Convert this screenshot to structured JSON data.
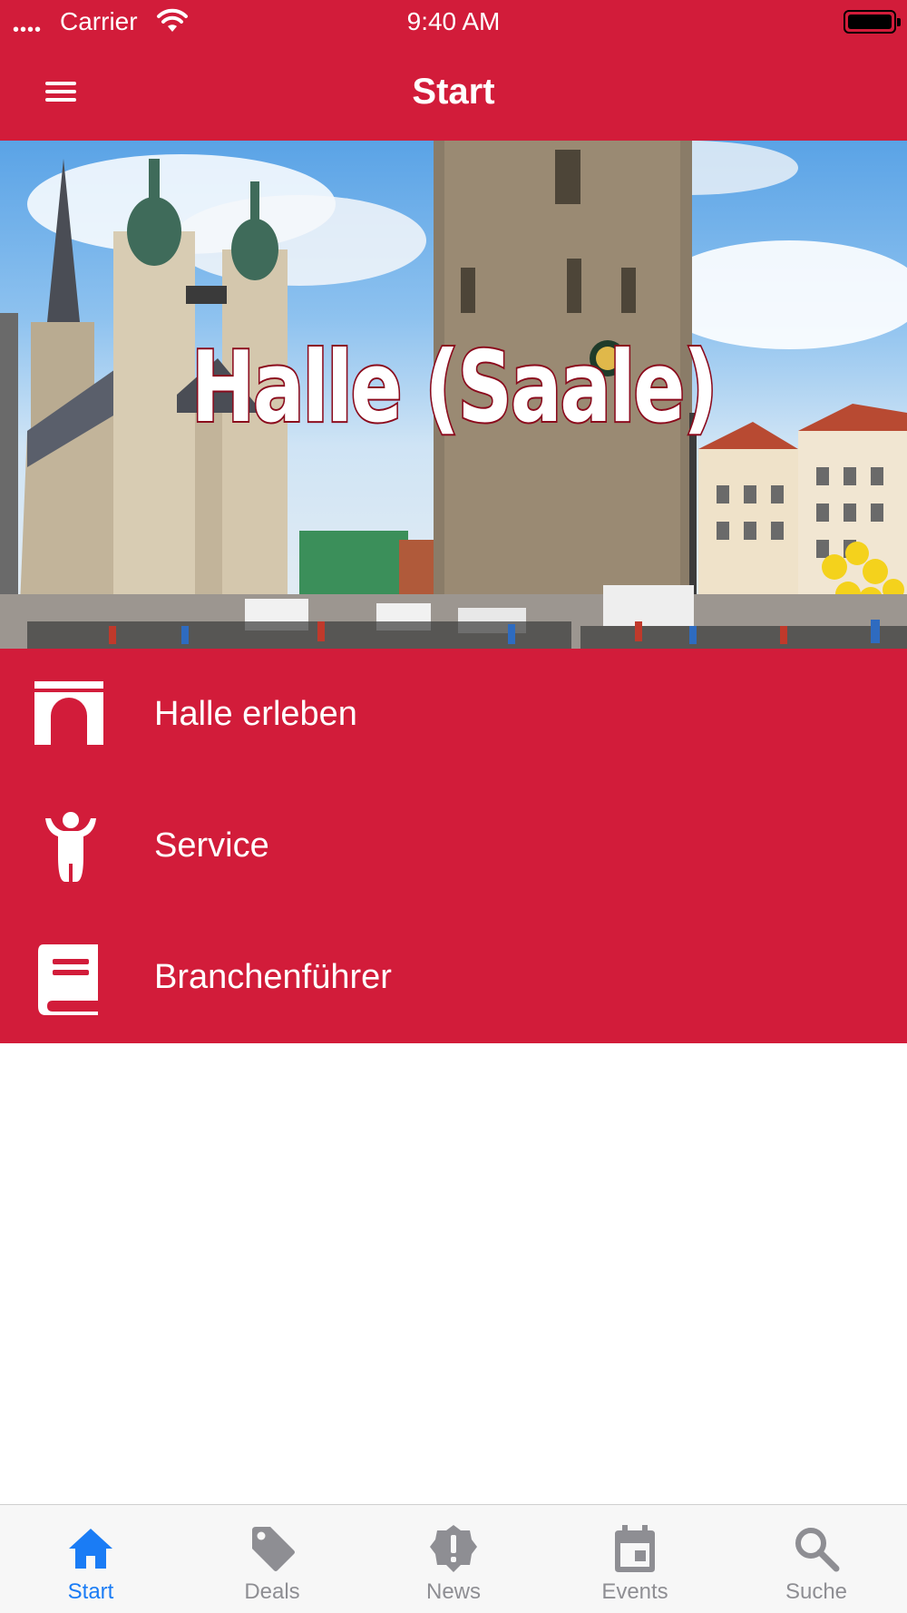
{
  "status_bar": {
    "carrier": "Carrier",
    "time": "9:40 AM",
    "icons": [
      "signal-dots",
      "wifi-icon",
      "battery-icon"
    ]
  },
  "nav_bar": {
    "title": "Start",
    "menu_icon": "hamburger-menu-icon"
  },
  "hero": {
    "title": "Halle (Saale)"
  },
  "menu": {
    "items": [
      {
        "label": "Halle erleben",
        "icon": "gate-arch-icon"
      },
      {
        "label": "Service",
        "icon": "person-icon"
      },
      {
        "label": "Branchenführer",
        "icon": "book-icon"
      }
    ]
  },
  "tab_bar": {
    "items": [
      {
        "label": "Start",
        "icon": "home-icon",
        "active": true
      },
      {
        "label": "Deals",
        "icon": "tag-icon",
        "active": false
      },
      {
        "label": "News",
        "icon": "alert-badge-icon",
        "active": false
      },
      {
        "label": "Events",
        "icon": "calendar-icon",
        "active": false
      },
      {
        "label": "Suche",
        "icon": "search-icon",
        "active": false
      }
    ]
  },
  "colors": {
    "brand_red": "#d21c3a",
    "tab_active": "#1a7cf5",
    "tab_inactive": "#8e8e93"
  }
}
